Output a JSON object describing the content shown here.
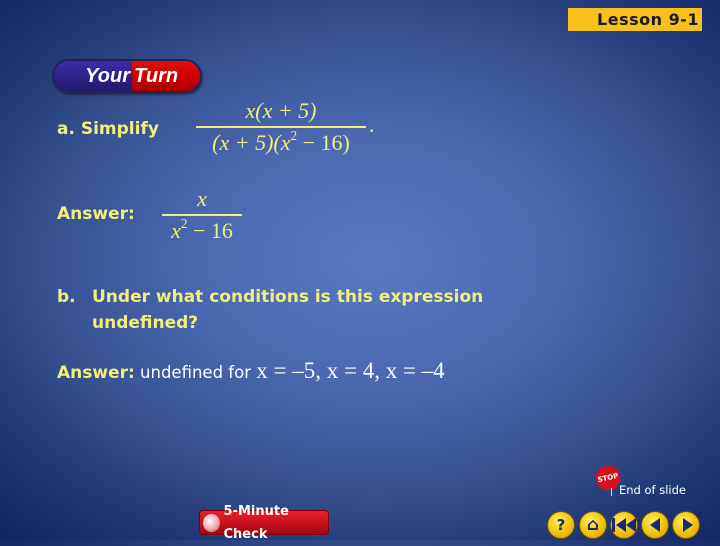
{
  "header": {
    "lesson_tag": "Lesson 9-1"
  },
  "badge": {
    "left": "Your",
    "right": "Turn"
  },
  "part_a": {
    "label": "a.  Simplify",
    "expression": {
      "numerator": "x(x + 5)",
      "denominator_pre": "(x + 5)(x",
      "denominator_exp": "2",
      "denominator_post": " − 16)",
      "trailing": "."
    },
    "answer_label": "Answer:",
    "answer": {
      "numerator": "x",
      "denominator_base": "x",
      "denominator_exp": "2",
      "denominator_post": " − 16"
    }
  },
  "part_b": {
    "label": "b.",
    "question_line1": "Under what conditions is this expression",
    "question_line2": "undefined?",
    "answer_label": "Answer:",
    "answer_text": " undefined for ",
    "answer_math": "x = –5, x = 4, x = –4"
  },
  "footer": {
    "five_minute_check": "5-Minute Check",
    "end_of_slide": "End of slide",
    "stop_text": "STOP",
    "nav": [
      {
        "name": "help",
        "glyph": "?"
      },
      {
        "name": "home",
        "glyph": "⌂"
      },
      {
        "name": "first",
        "glyph": ""
      },
      {
        "name": "previous",
        "glyph": ""
      },
      {
        "name": "next",
        "glyph": ""
      }
    ]
  },
  "colors": {
    "accent_yellow": "#f3ef7a",
    "tag_gold": "#f6c11a",
    "badge_red": "#c80000",
    "badge_blue": "#2a1f86"
  }
}
